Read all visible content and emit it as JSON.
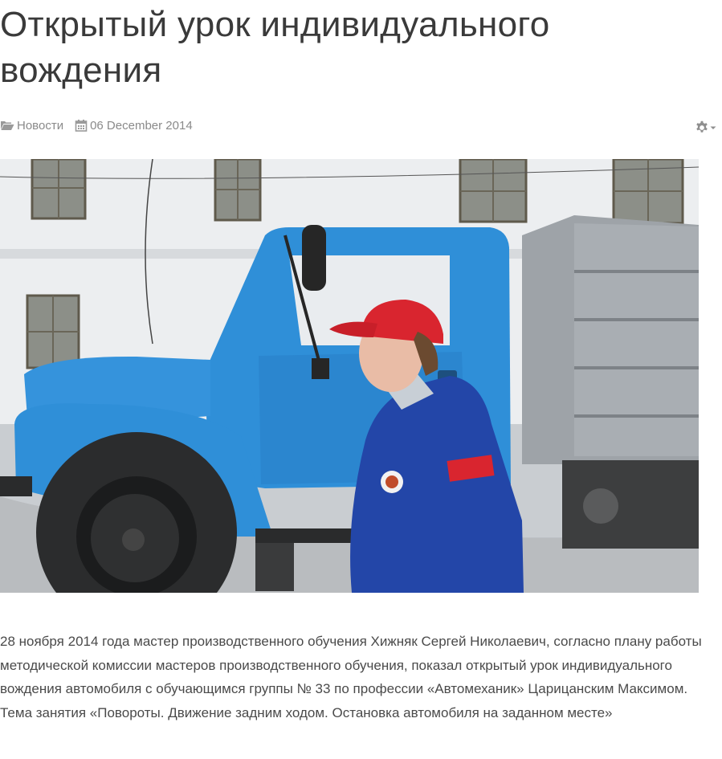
{
  "article": {
    "title": "Открытый урок индивидуального вождения",
    "category": "Новости",
    "date": "06 December 2014",
    "body": "28 ноября 2014 года  мастер производственного обучения Хижняк Сергей Николаевич, согласно плану работы методической комиссии мастеров производственного обучения, показал открытый урок индивидуального вождения автомобиля с обучающимся группы № 33 по профессии «Автомеханик» Царицанским Максимом. Тема занятия «Повороты. Движение задним ходом. Остановка автомобиля на заданном месте»"
  },
  "icons": {
    "category": "folder-open-icon",
    "date": "calendar-icon",
    "tools": "gear-icon"
  },
  "colors": {
    "title": "#3a3a3a",
    "meta": "#8a8a8a",
    "body": "#4a4a4a",
    "truck": "#2f8fd8",
    "cap": "#d9252f",
    "uniform": "#2346a8"
  }
}
